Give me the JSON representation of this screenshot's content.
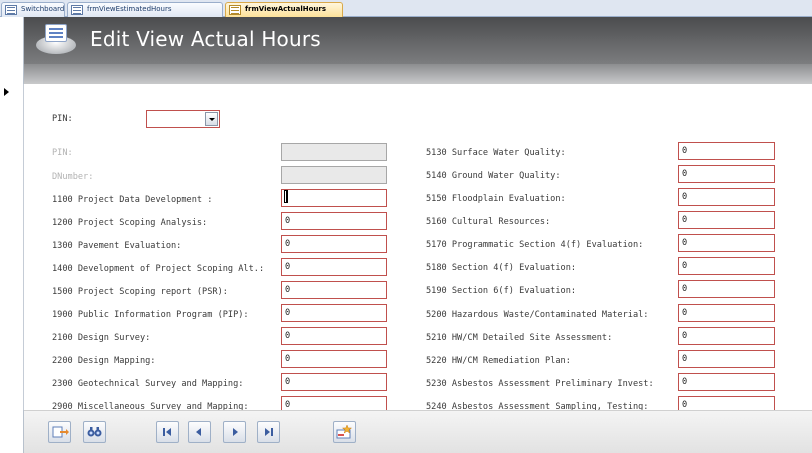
{
  "tabs": [
    {
      "label": "Switchboard",
      "active": false
    },
    {
      "label": "frmViewEstimatedHours",
      "active": false
    },
    {
      "label": "frmViewActualHours",
      "active": true
    }
  ],
  "header": {
    "title": "Edit View Actual Hours"
  },
  "filter": {
    "pin_label": "PIN:",
    "pin_value": ""
  },
  "left_fields": [
    {
      "label": "PIN:",
      "value": "",
      "enabled": false
    },
    {
      "label": "DNumber:",
      "value": "",
      "enabled": false
    },
    {
      "label": "1100 Project Data Development :",
      "value": "",
      "enabled": true,
      "focused": true
    },
    {
      "label": "1200 Project Scoping Analysis:",
      "value": "0",
      "enabled": true
    },
    {
      "label": "1300 Pavement Evaluation:",
      "value": "0",
      "enabled": true
    },
    {
      "label": "1400 Development of Project Scoping Alt.:",
      "value": "0",
      "enabled": true
    },
    {
      "label": "1500 Project Scoping report (PSR):",
      "value": "0",
      "enabled": true
    },
    {
      "label": "1900 Public Information Program (PIP):",
      "value": "0",
      "enabled": true
    },
    {
      "label": "2100 Design Survey:",
      "value": "0",
      "enabled": true
    },
    {
      "label": "2200 Design Mapping:",
      "value": "0",
      "enabled": true
    },
    {
      "label": "2300 Geotechnical Survey and Mapping:",
      "value": "0",
      "enabled": true
    },
    {
      "label": "2900 Miscellaneous Survey and Mapping:",
      "value": "0",
      "enabled": true
    }
  ],
  "right_fields": [
    {
      "label": "5130 Surface Water Quality:",
      "value": "0"
    },
    {
      "label": "5140 Ground Water Quality:",
      "value": "0"
    },
    {
      "label": "5150 Floodplain Evaluation:",
      "value": "0"
    },
    {
      "label": "5160 Cultural Resources:",
      "value": "0"
    },
    {
      "label": "5170 Programmatic Section 4(f) Evaluation:",
      "value": "0"
    },
    {
      "label": "5180 Section 4(f) Evaluation:",
      "value": "0"
    },
    {
      "label": "5190 Section 6(f) Evaluation:",
      "value": "0"
    },
    {
      "label": "5200 Hazardous Waste/Contaminated Material:",
      "value": "0"
    },
    {
      "label": "5210 HW/CM Detailed Site Assessment:",
      "value": "0"
    },
    {
      "label": "5220 HW/CM Remediation Plan:",
      "value": "0"
    },
    {
      "label": "5230 Asbestos Assessment Preliminary Invest:",
      "value": "0"
    },
    {
      "label": "5240 Asbestos Assessment Sampling, Testing:",
      "value": "0"
    }
  ],
  "footer": {
    "buttons": [
      {
        "name": "open-form-icon"
      },
      {
        "name": "find-icon"
      },
      {
        "name": "first-record-icon"
      },
      {
        "name": "previous-record-icon"
      },
      {
        "name": "next-record-icon"
      },
      {
        "name": "last-record-icon"
      },
      {
        "name": "new-record-icon"
      }
    ]
  },
  "colors": {
    "field_border": "#c0504d",
    "header_bg": "#5a5b5d",
    "active_tab": "#fde29a"
  }
}
